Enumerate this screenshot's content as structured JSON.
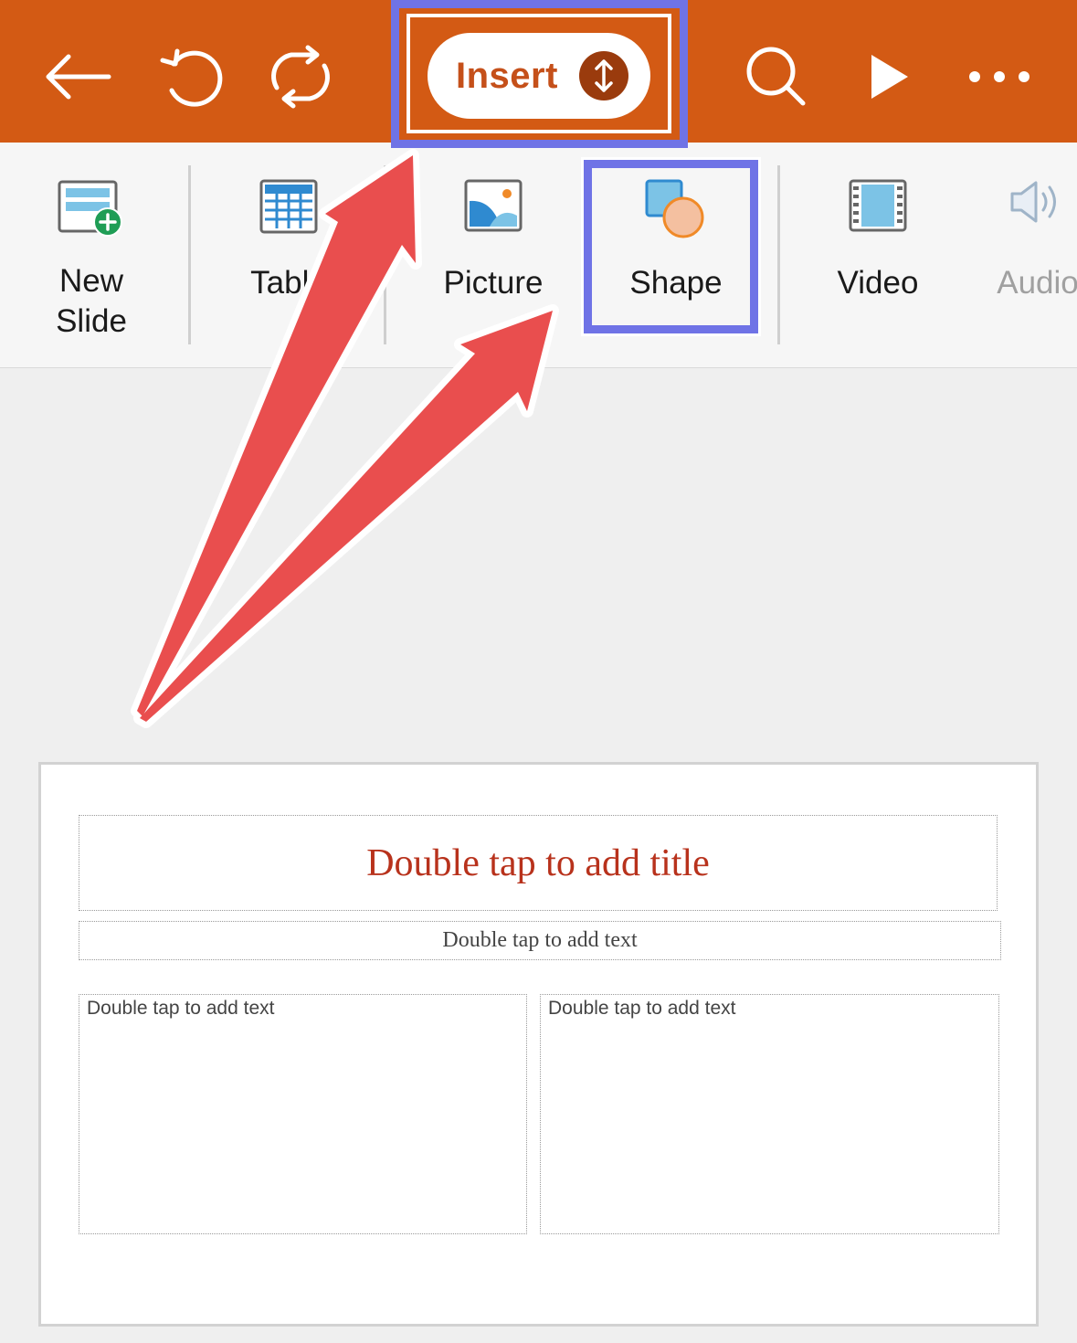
{
  "toolbar": {
    "back_icon": "arrow-left-icon",
    "undo_icon": "undo-icon",
    "redo_icon": "redo-icon",
    "insert_label": "Insert",
    "insert_toggle_icon": "up-down-arrows-icon",
    "search_icon": "search-icon",
    "play_icon": "play-icon",
    "more_icon": "more-horizontal-icon",
    "background": "#d35a14"
  },
  "ribbon": {
    "items": [
      {
        "label": "New\nSlide",
        "icon": "new-slide-icon"
      },
      {
        "label": "Table",
        "icon": "table-icon"
      },
      {
        "label": "Picture",
        "icon": "picture-icon"
      },
      {
        "label": "Shape",
        "icon": "shape-icon"
      },
      {
        "label": "Video",
        "icon": "video-icon"
      },
      {
        "label": "Audio",
        "icon": "audio-icon"
      }
    ]
  },
  "slide": {
    "title_placeholder": "Double tap to add title",
    "subtitle_placeholder": "Double tap to add text",
    "left_placeholder": "Double tap to add text",
    "right_placeholder": "Double tap to add text",
    "title_color": "#b8321c"
  },
  "annotations": {
    "highlight_color": "#6f73e6",
    "arrow_color": "#e94e4e"
  }
}
